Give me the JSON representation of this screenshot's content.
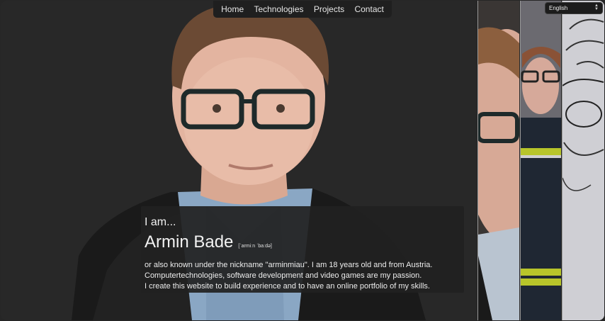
{
  "nav": {
    "items": [
      {
        "label": "Home"
      },
      {
        "label": "Technologies"
      },
      {
        "label": "Projects"
      },
      {
        "label": "Contact"
      }
    ]
  },
  "language": {
    "selected": "English"
  },
  "intro": {
    "greeting": "I am...",
    "name": "Armin Bade",
    "pronunciation": "[ˈarmiːn ˈbaːdə]",
    "lines": [
      "or also known under the nickname \"arminmiau\". I am 18 years old and from Austria.",
      "Computertechnologies, software development and video games are my passion.",
      "I create this website to build experience and to have an online portfolio of my skills."
    ]
  },
  "colors": {
    "background": "#262626",
    "nav_background": "#1f1f1f",
    "card_background": "#212121",
    "text": "#f2f2f2"
  },
  "icons": [
    "select-arrows-icon"
  ]
}
